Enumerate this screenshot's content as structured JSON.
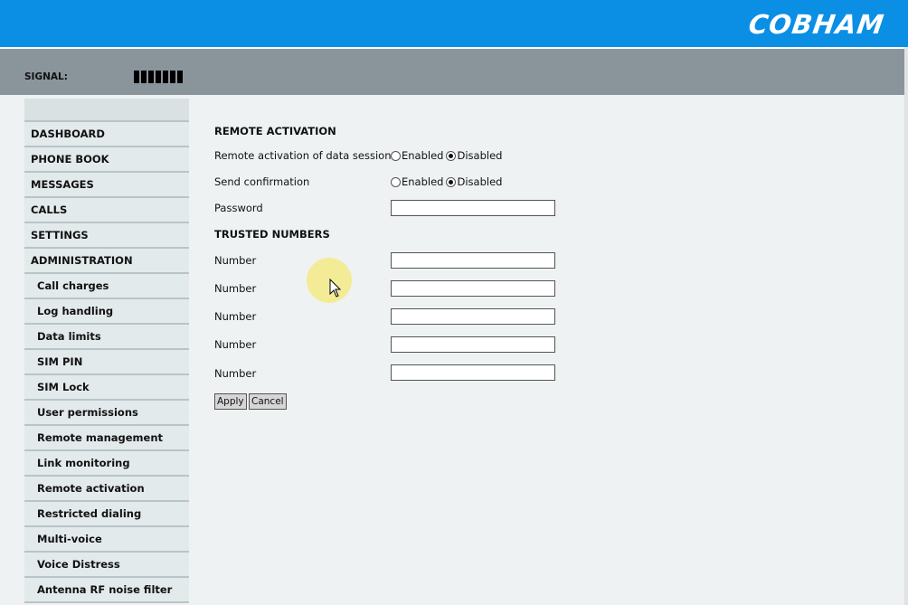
{
  "header": {
    "logo": "COBHAM",
    "brand_color": "#0a8fe5"
  },
  "status": {
    "signal_label": "SIGNAL:",
    "signal_bars": 7
  },
  "sidebar": {
    "items": [
      {
        "label": "DASHBOARD",
        "sub": false
      },
      {
        "label": "PHONE BOOK",
        "sub": false
      },
      {
        "label": "MESSAGES",
        "sub": false
      },
      {
        "label": "CALLS",
        "sub": false
      },
      {
        "label": "SETTINGS",
        "sub": false
      },
      {
        "label": "ADMINISTRATION",
        "sub": false
      },
      {
        "label": "Call charges",
        "sub": true
      },
      {
        "label": "Log handling",
        "sub": true
      },
      {
        "label": "Data limits",
        "sub": true
      },
      {
        "label": "SIM PIN",
        "sub": true
      },
      {
        "label": "SIM Lock",
        "sub": true
      },
      {
        "label": "User permissions",
        "sub": true
      },
      {
        "label": "Remote management",
        "sub": true
      },
      {
        "label": "Link monitoring",
        "sub": true
      },
      {
        "label": "Remote activation",
        "sub": true
      },
      {
        "label": "Restricted dialing",
        "sub": true
      },
      {
        "label": "Multi-voice",
        "sub": true
      },
      {
        "label": "Voice Distress",
        "sub": true
      },
      {
        "label": "Antenna RF noise filter",
        "sub": true
      }
    ]
  },
  "form": {
    "remote_heading": "REMOTE ACTIVATION",
    "remote_activation": {
      "label": "Remote activation of data sessions",
      "enabled": "Enabled",
      "disabled": "Disabled",
      "selected": "Disabled"
    },
    "send_confirmation": {
      "label": "Send confirmation",
      "enabled": "Enabled",
      "disabled": "Disabled",
      "selected": "Disabled"
    },
    "password": {
      "label": "Password",
      "value": ""
    },
    "trusted_heading": "TRUSTED NUMBERS",
    "numbers": [
      {
        "label": "Number",
        "value": ""
      },
      {
        "label": "Number",
        "value": ""
      },
      {
        "label": "Number",
        "value": ""
      },
      {
        "label": "Number",
        "value": ""
      },
      {
        "label": "Number",
        "value": ""
      }
    ],
    "apply_label": "Apply",
    "cancel_label": "Cancel"
  }
}
